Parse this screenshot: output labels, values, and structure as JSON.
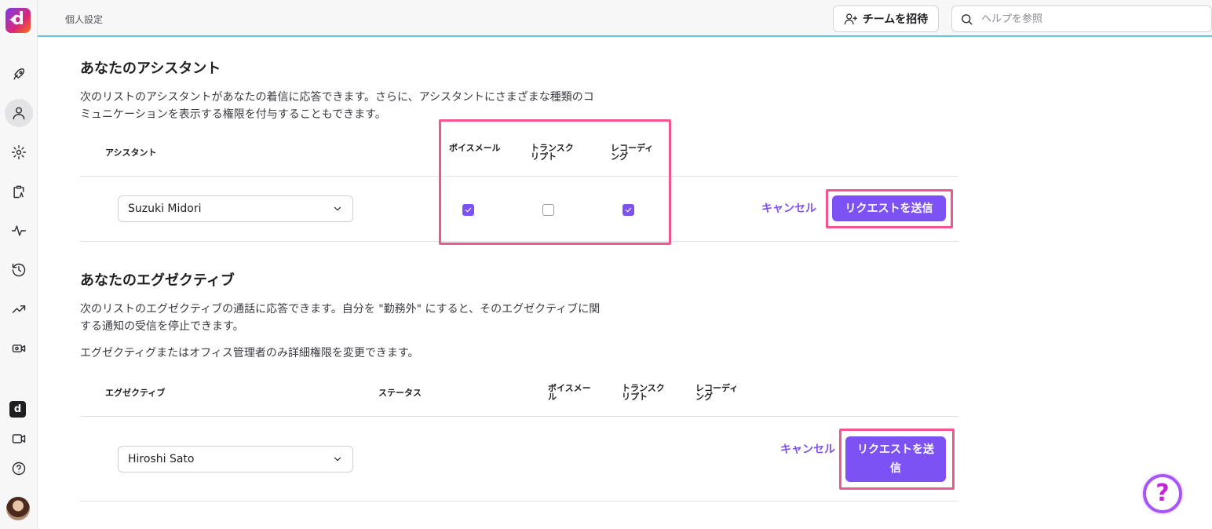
{
  "header": {
    "breadcrumb": "個人設定",
    "invite_label": "チームを招待",
    "help_search_placeholder": "ヘルプを参照"
  },
  "assistants": {
    "title": "あなたのアシスタント",
    "description": "次のリストのアシスタントがあなたの着信に応答できます。さらに、アシスタントにさまざまな種類のコミュニケーションを表示する権限を付与することもできます。",
    "columns": {
      "assistant": "アシスタント",
      "voicemail": "ボイスメール",
      "transcript": "トランスクリプト",
      "recording": "レコーディング"
    },
    "row": {
      "selected": "Suzuki Midori",
      "voicemail": true,
      "transcript": false,
      "recording": true,
      "cancel_label": "キャンセル",
      "send_label": "リクエストを送信"
    }
  },
  "executives": {
    "title": "あなたのエグゼクティブ",
    "description": "次のリストのエグゼクティブの通話に応答できます。自分を \"勤務外\" にすると、そのエグゼクティブに関する通知の受信を停止できます。",
    "note": "エグゼクティグまたはオフィス管理者のみ詳細権限を変更できます。",
    "columns": {
      "executive": "エグゼクティブ",
      "status": "ステータス",
      "voicemail": "ボイスメール",
      "transcript": "トランスクリプト",
      "recording": "レコーディング"
    },
    "row": {
      "selected": "Hiroshi Sato",
      "cancel_label": "キャンセル",
      "send_label": "リクエストを送信"
    }
  },
  "colors": {
    "accent": "#7c52f4",
    "highlight": "#f0568f",
    "header_rule": "#6fbfe0"
  },
  "icons": {
    "rail": [
      "rocket-icon",
      "user-icon",
      "gear-icon",
      "clipboard-icon",
      "activity-icon",
      "history-icon",
      "trending-icon",
      "video-group-icon",
      "video-icon",
      "help-circle-icon"
    ],
    "help_fab": "?"
  }
}
